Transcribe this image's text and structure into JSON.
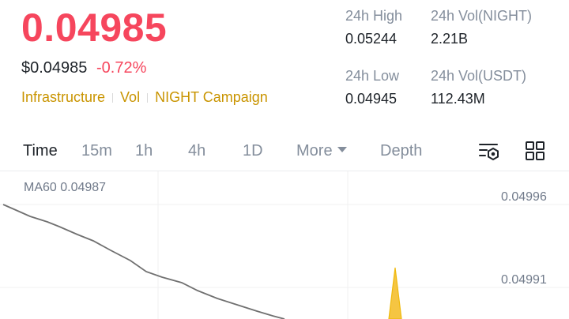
{
  "header": {
    "price": "0.04985",
    "fiat_price": "$0.04985",
    "change": "-0.72%",
    "tags": [
      "Infrastructure",
      "Vol",
      "NIGHT Campaign"
    ]
  },
  "stats": {
    "high_label": "24h High",
    "high_value": "0.05244",
    "vol_base_label": "24h Vol(NIGHT)",
    "vol_base_value": "2.21B",
    "low_label": "24h Low",
    "low_value": "0.04945",
    "vol_quote_label": "24h Vol(USDT)",
    "vol_quote_value": "112.43M"
  },
  "tabs": {
    "time": "Time",
    "m15": "15m",
    "h1": "1h",
    "h4": "4h",
    "d1": "1D",
    "more": "More",
    "depth": "Depth",
    "active": "Time"
  },
  "chart": {
    "ma_label": "MA60 0.04987",
    "y_ticks": [
      "0.04996",
      "0.04991"
    ]
  },
  "colors": {
    "down": "#f6465d",
    "accent": "#c99400",
    "muted": "#848e9c",
    "ma_line": "#707070",
    "spike": "#f0b90b"
  },
  "icons": {
    "settings": "chart-settings-icon",
    "grid": "grid-layout-icon"
  }
}
